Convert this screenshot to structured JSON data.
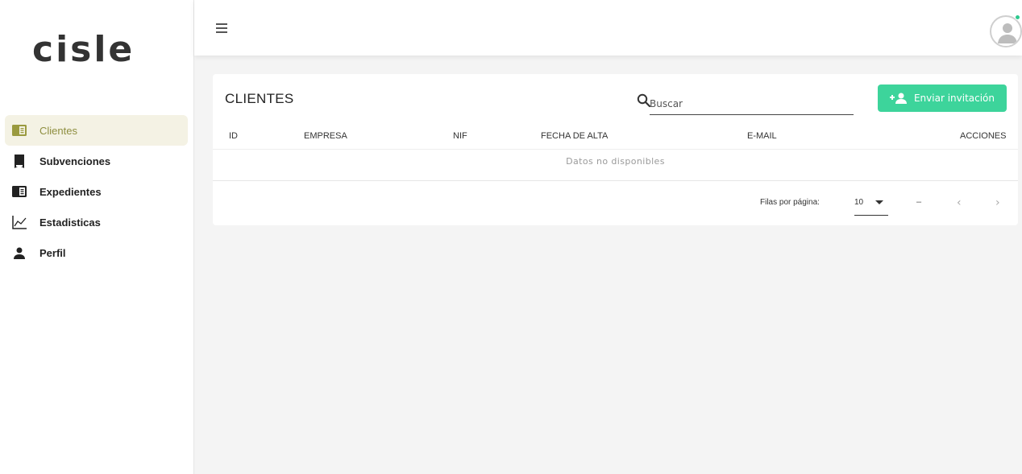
{
  "app": {
    "logo": "cisle"
  },
  "sidebar": {
    "items": [
      {
        "label": "Clientes",
        "icon": "book-open-icon",
        "active": true
      },
      {
        "label": "Subvenciones",
        "icon": "book-icon"
      },
      {
        "label": "Expedientes",
        "icon": "folder-book-icon"
      },
      {
        "label": "Estadisticas",
        "icon": "chart-line-icon"
      },
      {
        "label": "Perfil",
        "icon": "person-icon"
      }
    ]
  },
  "header": {
    "menu_icon": "menu-icon",
    "avatar_icon": "avatar-icon"
  },
  "main": {
    "title": "CLIENTES",
    "search": {
      "placeholder": "Buscar",
      "value": ""
    },
    "invite_button": "Enviar invitación",
    "columns": [
      "ID",
      "EMPRESA",
      "NIF",
      "FECHA DE ALTA",
      "E-MAIL",
      "ACCIONES"
    ],
    "rows": [],
    "empty_text": "Datos no disponibles",
    "pagination": {
      "rows_label": "Filas por página:",
      "rows_per_page": "10",
      "range": "–"
    }
  },
  "colors": {
    "accent": "#3dd49b",
    "active_bg": "#f4f2e4",
    "active_text": "#8e8e3f",
    "status_online": "#2ec98f"
  }
}
